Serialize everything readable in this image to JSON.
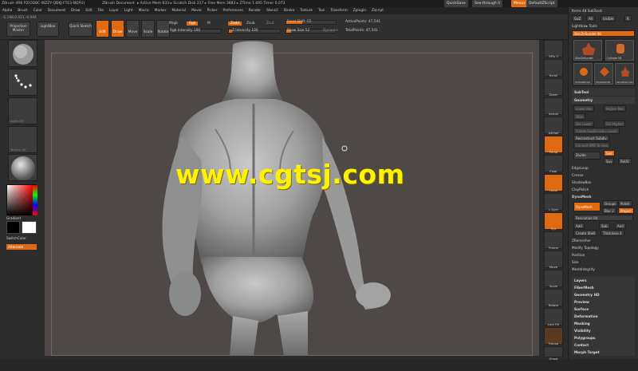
{
  "titlebar": {
    "app_title": "ZBrush 4R6 P2[ODBC-WZZY-QDKJ-FTE3-NQFU]",
    "doc_title": "ZBrush Document",
    "stats": "▸ Active Mem 633 ▸ Scratch Disk 217 ▸ Free Mem 3883 ▸ ZTime 1.695 Timer 0.073",
    "quicksave": "QuickSave",
    "seethrough": "See-through 0",
    "menus": "Menus",
    "default_script": "DefaultZScript"
  },
  "menubar": [
    "Alpha",
    "Brush",
    "Color",
    "Document",
    "Draw",
    "Edit",
    "File",
    "Layer",
    "Light",
    "Macro",
    "Marker",
    "Material",
    "Movie",
    "Picker",
    "Preferences",
    "Render",
    "Stencil",
    "Stroke",
    "Texture",
    "Tool",
    "Transform",
    "Zplugin",
    "Zscript"
  ],
  "toolbar": {
    "coords": "-1.198,0.021,-0.044",
    "projection_master": "Projection Master",
    "lightbox": "LightBox",
    "quick_sketch": "Quick Sketch",
    "edit": "Edit",
    "draw": "Draw",
    "move": "Move",
    "scale": "Scale",
    "rotate": "Rotate",
    "mrgb": "Mrgb",
    "rgb": "Rgb",
    "m": "M",
    "rgb_intensity": "Rgb Intensity 100",
    "zadd": "Zadd",
    "zsub": "Zsub",
    "zcut": "Zcut",
    "z_intensity": "Z Intensity 100",
    "focal_shift": "Focal Shift -55",
    "draw_size": "Draw Size 52",
    "dynamic": "Dynamic",
    "active_points": "ActivePoints: 47,541",
    "total_points": "TotalPoints: 47,541"
  },
  "left_shelf": {
    "alpha_off": "Alpha Off",
    "texture_off": "Texture Off",
    "gradient": "Gradient",
    "switch_color": "SwitchColor",
    "alternate": "Alternate"
  },
  "right_icons": [
    "SPix 3",
    "Scroll",
    "Zoom",
    "Actual",
    "AAHalf",
    "Persp",
    "Floor",
    "Local",
    "L.Sym",
    "Xyz",
    "Frame",
    "Move",
    "Scale",
    "Rotate",
    "Line Fill",
    "Transp",
    "Ghost",
    "Solo",
    "Xpose"
  ],
  "right_panel": {
    "item1": "Items 48 SubTools",
    "goz": "GoZ",
    "all": "All",
    "visible": "Visible",
    "r": "R",
    "lightbox_tools": "Lightbox▸ Tools",
    "skin_label": "SkinZeSundel 48",
    "tools": [
      "SkinZeSundel",
      "Cylinder3D",
      "PolyMesh3D",
      "SimpleBrush",
      "SkinZeSundel"
    ],
    "subtool": "SubTool",
    "geometry": "Geometry",
    "lower_res": "Lower Res",
    "higher_res": "Higher Res",
    "sdiv": "SDiv",
    "del_lower": "Del Lower",
    "del_higher": "Del Higher",
    "freeze_subdiv": "Freeze SubDivision Levels",
    "reconstruct": "Reconstruct Subdiv",
    "convert_bpr": "Convert BPR To Geo",
    "divide": "Divide",
    "smt": "Smt",
    "suv": "Suv",
    "rsmt": "ReUV",
    "edgeloop": "EdgeLoop",
    "crease": "Crease",
    "shadowbox": "ShadowBox",
    "claypolish": "ClayPolish",
    "dynamesh_sec": "DynaMesh",
    "groups": "Groups",
    "polish": "Polish",
    "dynamesh": "DynaMesh",
    "blur": "Blur 2",
    "project": "Project",
    "resolution": "Resolution 84",
    "add": "Add",
    "sub": "Sub",
    "and": "And",
    "create_shell": "Create Shell",
    "thickness": "Thickness 4",
    "zremesher": "ZRemesher",
    "modify_topology": "Modify Topology",
    "position": "Position",
    "size": "Size",
    "meshintegrity": "MeshIntegrity",
    "sections": [
      "Layers",
      "FiberMesh",
      "Geometry HD",
      "Preview",
      "Surface",
      "Deformation",
      "Masking",
      "Visibility",
      "Polygroups",
      "Contact",
      "Morph Target"
    ]
  },
  "watermark": "www.cgtsj.com",
  "colors": {
    "accent": "#e06a12",
    "viewport": "#4e4846",
    "panel": "#2e2e2e"
  }
}
